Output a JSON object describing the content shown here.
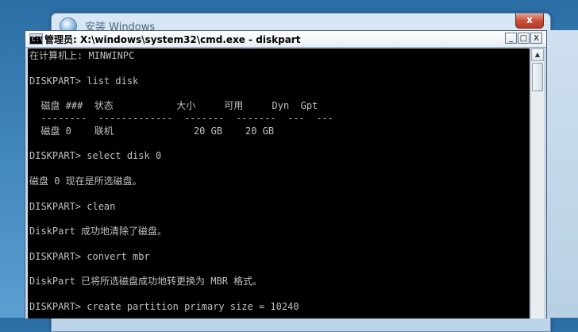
{
  "background_window": {
    "title": "安装 Windows",
    "close_label": "x"
  },
  "cmd_window": {
    "title": "管理员: X:\\windows\\system32\\cmd.exe - diskpart",
    "buttons": {
      "minimize": "_",
      "maximize": "□",
      "close": "X"
    }
  },
  "console": {
    "lines": [
      "在计算机上: MINWINPC",
      "",
      "DISKPART> list disk",
      "",
      "  磁盘 ###  状态           大小     可用     Dyn  Gpt",
      "  --------  -------------  -------  -------  ---  ---",
      "  磁盘 0    联机              20 GB    20 GB",
      "",
      "DISKPART> select disk 0",
      "",
      "磁盘 0 现在是所选磁盘。",
      "",
      "DISKPART> clean",
      "",
      "DiskPart 成功地清除了磁盘。",
      "",
      "DISKPART> convert mbr",
      "",
      "DiskPart 已将所选磁盘成功地转更换为 MBR 格式。",
      "",
      "DISKPART> create partition primary size = 10240"
    ]
  },
  "scrollbar": {
    "up_arrow": "▲"
  },
  "colors": {
    "console_bg": "#000000",
    "console_text": "#c0c0c0",
    "desktop": "#3f86bd"
  }
}
